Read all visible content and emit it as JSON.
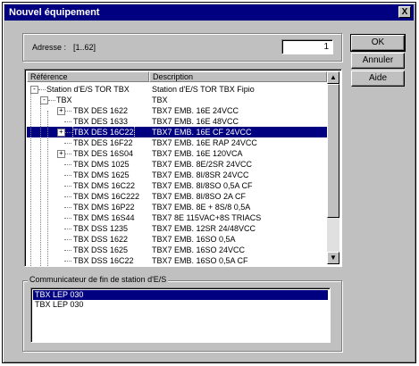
{
  "window": {
    "title": "Nouvel équipement",
    "close_glyph": "X"
  },
  "address": {
    "label": "Adresse :",
    "range": "[1..62]",
    "value": "1"
  },
  "buttons": {
    "ok": "OK",
    "cancel": "Annuler",
    "help": "Aide"
  },
  "tree": {
    "headers": {
      "reference": "Référence",
      "description": "Description"
    },
    "rows": [
      {
        "ref": "Station d'E/S TOR TBX",
        "desc": "Station d'E/S TOR TBX Fipio",
        "level": 0,
        "expander": "-"
      },
      {
        "ref": "TBX",
        "desc": "TBX",
        "level": 1,
        "expander": "-"
      },
      {
        "ref": "TBX DES 1622",
        "desc": "TBX7 EMB. 16E 24VCC",
        "level": 2,
        "expander": "+"
      },
      {
        "ref": "TBX DES 1633",
        "desc": "TBX7 EMB. 16E 48VCC",
        "level": 2,
        "expander": ""
      },
      {
        "ref": "TBX DES 16C22",
        "desc": "TBX7 EMB. 16E CF 24VCC",
        "level": 2,
        "expander": "+",
        "selected": true
      },
      {
        "ref": "TBX DES 16F22",
        "desc": "TBX7 EMB. 16E RAP 24VCC",
        "level": 2,
        "expander": ""
      },
      {
        "ref": "TBX DES 16S04",
        "desc": "TBX7 EMB. 16E 120VCA",
        "level": 2,
        "expander": "+"
      },
      {
        "ref": "TBX DMS 1025",
        "desc": "TBX7 EMB. 8E/2SR 24VCC",
        "level": 2,
        "expander": ""
      },
      {
        "ref": "TBX DMS 1625",
        "desc": "TBX7 EMB. 8I/8SR 24VCC",
        "level": 2,
        "expander": ""
      },
      {
        "ref": "TBX DMS 16C22",
        "desc": "TBX7 EMB. 8I/8SO 0,5A CF",
        "level": 2,
        "expander": ""
      },
      {
        "ref": "TBX DMS 16C222",
        "desc": "TBX7 EMB. 8I/8SO 2A CF",
        "level": 2,
        "expander": ""
      },
      {
        "ref": "TBX DMS 16P22",
        "desc": "TBX7 EMB. 8E + 8S/8 0,5A",
        "level": 2,
        "expander": ""
      },
      {
        "ref": "TBX DMS 16S44",
        "desc": "TBX7 8E 115VAC+8S TRIACS",
        "level": 2,
        "expander": ""
      },
      {
        "ref": "TBX DSS 1235",
        "desc": "TBX7 EMB. 12SR 24/48VCC",
        "level": 2,
        "expander": ""
      },
      {
        "ref": "TBX DSS 1622",
        "desc": "TBX7 EMB. 16SO 0,5A",
        "level": 2,
        "expander": ""
      },
      {
        "ref": "TBX DSS 1625",
        "desc": "TBX7 EMB. 16SO 24VCC",
        "level": 2,
        "expander": ""
      },
      {
        "ref": "TBX DSS 16C22",
        "desc": "TBX7 EMB. 16SO 0,5A CF",
        "level": 2,
        "expander": ""
      }
    ]
  },
  "communicator": {
    "legend": "Communicateur de fin de station d'E/S",
    "items": [
      {
        "label": "TBX LEP 030",
        "selected": true
      },
      {
        "label": "TBX LEP 030",
        "selected": false
      }
    ]
  },
  "colors": {
    "selection": "#000080",
    "face": "#c0c0c0",
    "titlebar": "#000080"
  }
}
